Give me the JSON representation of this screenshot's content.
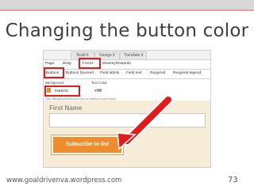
{
  "slide": {
    "title": "Changing the button color",
    "footer_url": "www.goaldrivenva.wordpress.com",
    "page_number": "73"
  },
  "editor": {
    "top_tabs": [
      "Build it",
      "Design it",
      "Translate it"
    ],
    "nav_tabs": [
      "Page",
      "Body",
      "Forms",
      "MonkeyRewards"
    ],
    "sub_tabs": [
      "Buttons",
      "Buttons hovered",
      "Field labels",
      "Field text",
      "Required",
      "Required legend"
    ],
    "background_label": "Background",
    "text_color_label": "Text Color",
    "background_hex": "#ee9c31",
    "text_hex": "#ffffff",
    "tip": "Tips: Background and text color of buttons in your forms.",
    "swatch_color": "#ec8c2b",
    "highlight_color": "#e01b1b"
  },
  "form_preview": {
    "first_name_label": "First Name",
    "subscribe_label": "Subscribe to list"
  }
}
